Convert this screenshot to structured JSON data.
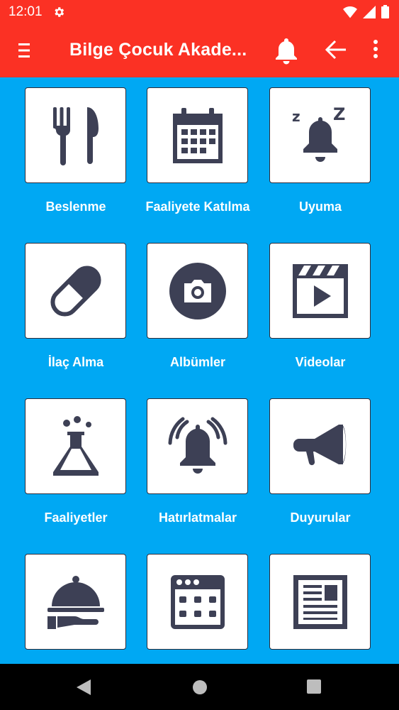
{
  "status": {
    "time": "12:01"
  },
  "appbar": {
    "title": "Bilge Çocuk Akade..."
  },
  "colors": {
    "accent": "#fb3124",
    "background": "#00a8f3",
    "icon": "#3d4055"
  },
  "tiles": [
    {
      "label": "Beslenme",
      "icon": "fork-knife-icon"
    },
    {
      "label": "Faaliyete Katılma",
      "icon": "calendar-icon"
    },
    {
      "label": "Uyuma",
      "icon": "sleep-bell-icon"
    },
    {
      "label": "İlaç Alma",
      "icon": "pill-icon"
    },
    {
      "label": "Albümler",
      "icon": "camera-icon"
    },
    {
      "label": "Videolar",
      "icon": "video-clapper-icon"
    },
    {
      "label": "Faaliyetler",
      "icon": "flask-icon"
    },
    {
      "label": "Hatırlatmalar",
      "icon": "ringing-bell-icon"
    },
    {
      "label": "Duyurular",
      "icon": "megaphone-icon"
    },
    {
      "label": "",
      "icon": "food-cloche-icon"
    },
    {
      "label": "",
      "icon": "calendar-grid-icon"
    },
    {
      "label": "",
      "icon": "newspaper-icon"
    }
  ]
}
